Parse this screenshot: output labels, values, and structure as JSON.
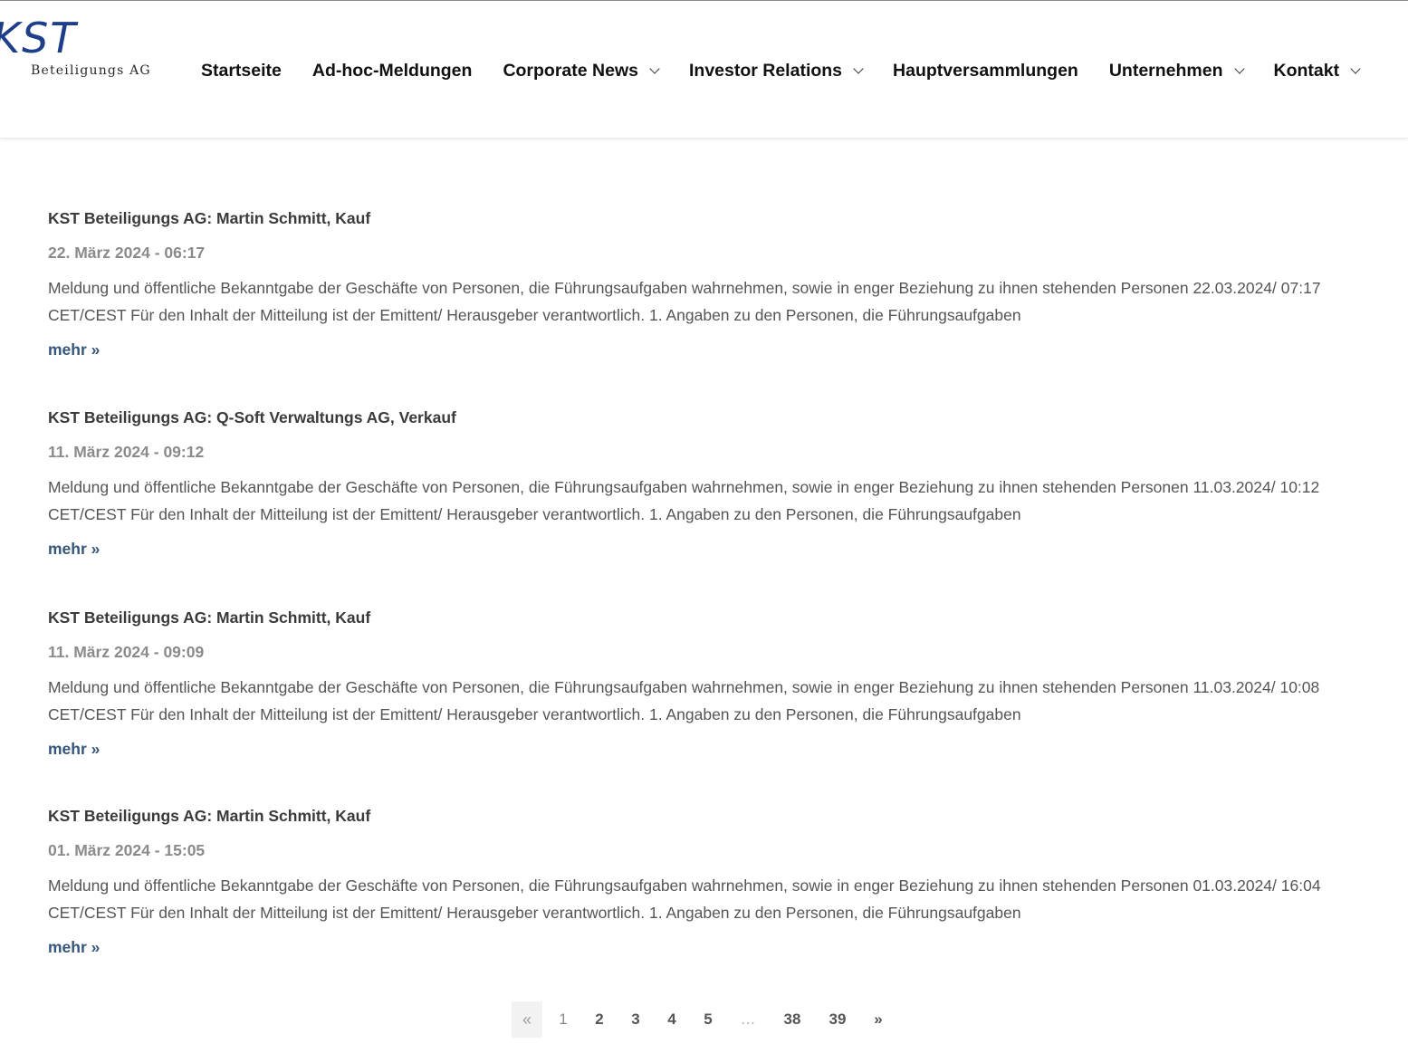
{
  "header": {
    "logo_text": "KST",
    "logo_subtitle": "Beteiligungs AG",
    "nav": [
      {
        "label": "Startseite",
        "has_dropdown": false
      },
      {
        "label": "Ad-hoc-Meldungen",
        "has_dropdown": false
      },
      {
        "label": "Corporate News",
        "has_dropdown": true
      },
      {
        "label": "Investor Relations",
        "has_dropdown": true
      },
      {
        "label": "Hauptversammlungen",
        "has_dropdown": false
      },
      {
        "label": "Unternehmen",
        "has_dropdown": true
      },
      {
        "label": "Kontakt",
        "has_dropdown": true
      }
    ]
  },
  "posts": [
    {
      "title": "KST Beteiligungs AG: Martin Schmitt, Kauf",
      "date": "22. März 2024 - 06:17",
      "excerpt": "Meldung und öffentliche Bekanntgabe der Geschäfte von Personen, die Führungsaufgaben wahrnehmen, sowie in enger Beziehung zu ihnen stehenden Personen 22.03.2024/ 07:17 CET/CEST Für den Inhalt der Mitteilung ist der Emittent/ Herausgeber verantwortlich. 1. Angaben zu den Personen, die Führungsaufgaben",
      "more": "mehr »"
    },
    {
      "title": "KST Beteiligungs AG: Q-Soft Verwaltungs AG, Verkauf",
      "date": "11. März 2024 - 09:12",
      "excerpt": "Meldung und öffentliche Bekanntgabe der Geschäfte von Personen, die Führungsaufgaben wahrnehmen, sowie in enger Beziehung zu ihnen stehenden Personen 11.03.2024/ 10:12 CET/CEST Für den Inhalt der Mitteilung ist der Emittent/ Herausgeber verantwortlich. 1. Angaben zu den Personen, die Führungsaufgaben",
      "more": "mehr »"
    },
    {
      "title": "KST Beteiligungs AG: Martin Schmitt, Kauf",
      "date": "11. März 2024 - 09:09",
      "excerpt": "Meldung und öffentliche Bekanntgabe der Geschäfte von Personen, die Führungsaufgaben wahrnehmen, sowie in enger Beziehung zu ihnen stehenden Personen 11.03.2024/ 10:08 CET/CEST Für den Inhalt der Mitteilung ist der Emittent/ Herausgeber verantwortlich. 1. Angaben zu den Personen, die Führungsaufgaben",
      "more": "mehr »"
    },
    {
      "title": "KST Beteiligungs AG: Martin Schmitt, Kauf",
      "date": "01. März 2024 - 15:05",
      "excerpt": "Meldung und öffentliche Bekanntgabe der Geschäfte von Personen, die Führungsaufgaben wahrnehmen, sowie in enger Beziehung zu ihnen stehenden Personen 01.03.2024/ 16:04 CET/CEST Für den Inhalt der Mitteilung ist der Emittent/ Herausgeber verantwortlich. 1. Angaben zu den Personen, die Führungsaufgaben",
      "more": "mehr »"
    }
  ],
  "pagination": {
    "prev": "«",
    "pages": [
      "1",
      "2",
      "3",
      "4",
      "5"
    ],
    "dots": "…",
    "last_pages": [
      "38",
      "39"
    ],
    "next": "»",
    "current": "1"
  },
  "colors": {
    "logo_blue": "#1e3e8a",
    "link": "#35567a",
    "date": "#8a8a8a",
    "text": "#555555"
  }
}
